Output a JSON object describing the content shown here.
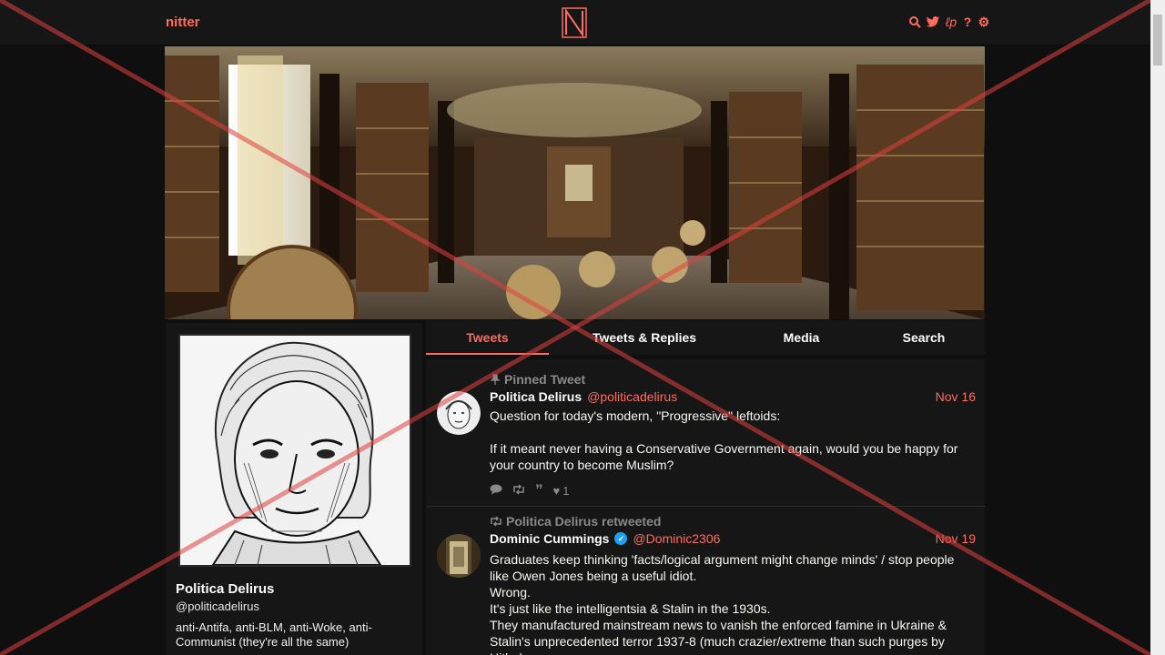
{
  "nav": {
    "brand": "nitter",
    "logo_letter": "N",
    "icons": [
      "search-icon",
      "twitter-icon",
      "rss-icon",
      "help-icon",
      "gear-icon"
    ]
  },
  "colors": {
    "accent": "#ff6c60",
    "background": "#0f0f0f",
    "panel": "#161616"
  },
  "profile": {
    "name": "Politica Delirus",
    "handle": "@politicadelirus",
    "bio": "anti-Antifa, anti-BLM, anti-Woke, anti-Communist (they're all the same)"
  },
  "tabs": [
    {
      "label": "Tweets",
      "active": true
    },
    {
      "label": "Tweets & Replies",
      "active": false
    },
    {
      "label": "Media",
      "active": false
    },
    {
      "label": "Search",
      "active": false
    }
  ],
  "tweets": [
    {
      "context": "Pinned Tweet",
      "name": "Politica Delirus",
      "username": "@politicadelirus",
      "date": "Nov 16",
      "body": "Question for today's modern, \"Progressive\" leftoids:\n\nIf it meant never having a Conservative Government again, would you be happy for your country to become Muslim?",
      "likes": "1"
    },
    {
      "context": "Politica Delirus retweeted",
      "name": "Dominic Cummings",
      "username": "@Dominic2306",
      "date": "Nov 19",
      "body": "Graduates keep thinking 'facts/logical argument might change minds' / stop people like Owen Jones being a useful idiot.\nWrong.\nIt's just like the intelligentsia & Stalin in the 1930s.\nThey manufactured mainstream news to vanish the enforced famine in Ukraine & Stalin's unprecedented terror 1937-8 (much crazier/extreme than such purges by Hitler)"
    }
  ]
}
